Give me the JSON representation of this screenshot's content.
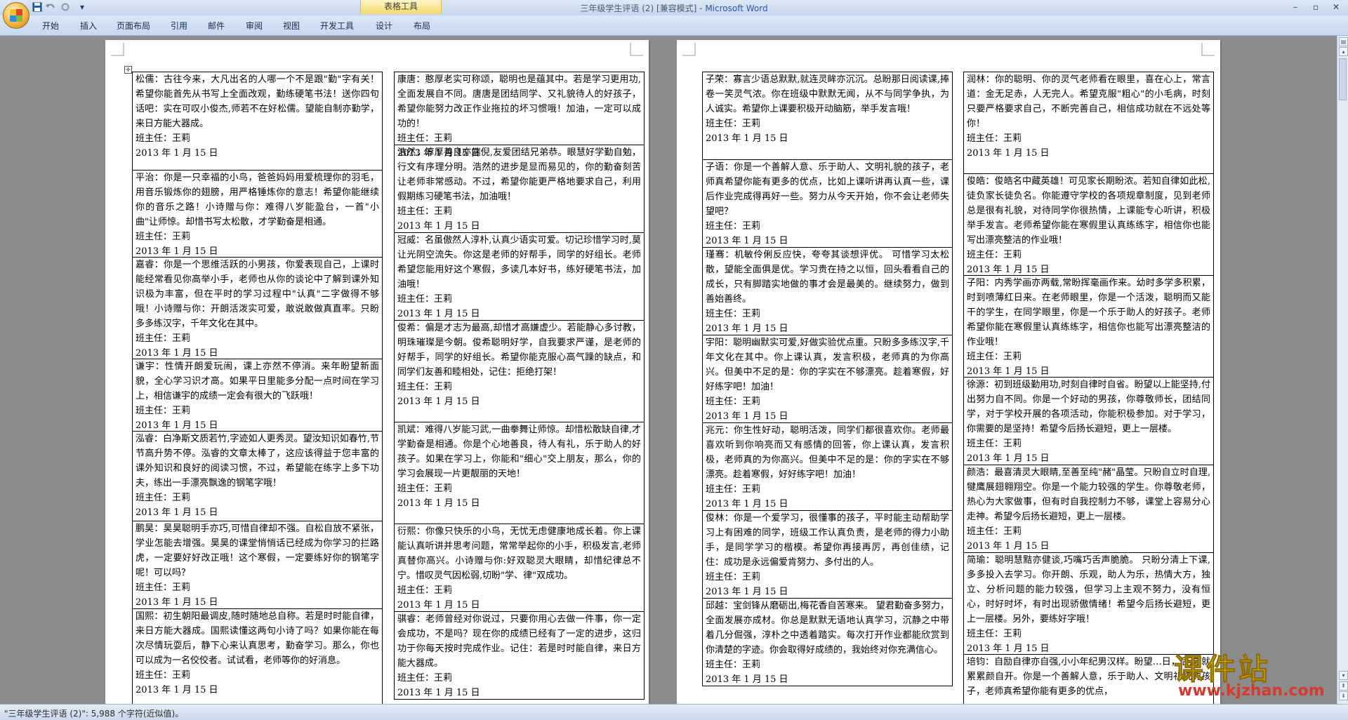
{
  "window": {
    "title": "三年级学生评语 (2) [兼容模式] - ",
    "app_name": "Microsoft Word",
    "context_tab_group": "表格工具",
    "minimize": "–",
    "restore": "▫",
    "close": "✕"
  },
  "qat": {
    "more": "▾"
  },
  "ribbon": {
    "tabs": [
      "开始",
      "插入",
      "页面布局",
      "引用",
      "邮件",
      "审阅",
      "视图",
      "开发工具",
      "设计",
      "布局"
    ],
    "help": "?"
  },
  "status": {
    "text": "\"三年级学生评语 (2)\": 5,988 个字符(近似值)。"
  },
  "watermark": {
    "title": "课件站",
    "url": "www.kjzhan.com"
  },
  "pages": [
    {
      "columns": [
        [
          {
            "text": "松儒：古往今来，大凡出名的人哪一个不是跟\"勤\"字有关！希望你能首先从书写上全面改观，勤练硬笔书法！送你四句话吧：实在可叹小俊杰,师若不在好松儒。望能自制亦勤学，来日方能大器成。",
            "teacher": "班主任：王莉",
            "date": "2013 年 1 月 15 日"
          },
          {
            "text": "平治：你是一只幸福的小鸟，爸爸妈妈用爱梳理你的羽毛，用音乐锻炼你的翅膀，用严格锤炼你的意志！希望你能继续你的音乐之路！小诗赠与你：难得八岁能盈台，一首\"小曲\"让师惊。却惜书写太松散，才学勤奋是相通。",
            "teacher": "班主任：王莉",
            "date": "2013 年 1 月 15 日"
          },
          {
            "text": "嘉睿：你是一个思维活跃的小男孩，你爱表现自己，上课时能经常看见你高举小手，老师也从你的谈论中了解到课外知识极为丰富，但在平时的学习过程中\"认真\"二字做得不够哦！小诗赠与你：开朗活泼实可爱，敢说敢做真直率。只盼多多练汉字，千年文化在其中。",
            "teacher": "班主任：王莉",
            "date": "2013 年 1 月 15 日"
          },
          {
            "text": "谦宇：性情开朗爱玩闹，课上亦然不停消。来年盼望新面貌，全心学习识才高。如果平日里能多分配一点时间在学习上，相信谦宇的成绩一定会有很大的飞跃哦！",
            "teacher": "班主任：王莉",
            "date": "2013 年 1 月 15 日"
          },
          {
            "text": "泓睿：白净斯文质若竹,字迹如人更秀灵。望汝知识如春竹,节节高升势不停。泓睿的文章太棒了，这应该得益于您丰富的课外知识和良好的阅读习惯，不过，希望能在练字上多下功夫，练出一手漂亮飘逸的钢笔字哦！",
            "teacher": "班主任：王莉",
            "date": "2013 年 1 月 15 日"
          },
          {
            "text": "鹏昊：昊昊聪明手亦巧,可惜自律却不强。自松自放不紧张，学业怎能去增强。昊昊的课堂悄悄话已经成为你学习的拦路虎，一定要好好改正哦！这个寒假，一定要练好你的钢笔字呢！可以吗？",
            "teacher": "班主任：王莉",
            "date": "2013 年 1 月 15 日"
          },
          {
            "text": "国熙：初生朝阳最调皮,随时随地总自称。若是时时能自律，来日方能大器成。国熙读懂这两句小诗了吗？如果你能在每次尽情玩耍后，静下心来认真思考，勤奋学习。那么，你也可以成为一名佼佼者。试试看，老师等你的好消息。",
            "teacher": "班主任：王莉",
            "date": "2013 年 1 月 15 日"
          }
        ],
        [
          {
            "text": "康唐：憨厚老实可称颂，聪明也是蕴其中。若是学习更用功,全面发展自不同。唐唐是团结同学、又礼貌待人的好孩子，希望你能努力改正作业拖拉的坏习惯哦！加油，一定可以成功的！",
            "teacher": "班主任：王莉",
            "date": "2013 年 1 月 15 日"
          },
          {
            "text": "浩然：淳厚善良亦端倪,友爱团结兄弟恭。眼慧好学勤自勉，行文有序理分明。浩然的进步是显而易见的，你的勤奋刻苦让老师非常感动。不过，希望你能更严格地要求自己，利用假期练习硬笔书法，加油哦！",
            "teacher": "班主任：王莉",
            "date": "2013 年 1 月 15 日"
          },
          {
            "text": "冠威：名虽傲然人淳朴,认真少语实可爱。切记珍惜学习时,莫让光阴空流失。你这是老师的好帮手，同学的好组长。老师希望您能用好这个寒假，多读几本好书，练好硬笔书法，加油哦！",
            "teacher": "班主任：王莉",
            "date": "2013 年 1 月 15 日"
          },
          {
            "text": "俊希：偏是才志为最高,却惜才高嫌虚少。若能静心多讨教，明珠璀璨是今朝。俊希聪明好学，自我要求严谨，是老师的好帮手，同学的好组长。希望你能克服心高气躁的缺点，和同学们友善和睦相处，记住：拒绝打架！",
            "teacher": "班主任：王莉",
            "date": "2013 年 1 月 15 日"
          },
          {
            "text": "凯斌：难得八岁能习武,一曲拳舞让师惊。却惜松散缺自律,才学勤奋是相通。你是个心地善良，待人有礼，乐于助人的好孩子。如果在学习上，你能和\"细心\"交上朋友，那么，你的学习会展现一片更靓丽的天地！",
            "teacher": "班主任：王莉",
            "date": "2013 年 1 月 15 日"
          },
          {
            "text": "衍熙：你像只快乐的小鸟，无忧无虑健康地成长着。你上课能认真听讲并思考问题，常常举起你的小手，积极发言,老师真替你高兴。小诗赠与你:好双聪灵大眼睛，却惜纪律总不宁。惜叹灵气因松弱,切盼\"学、律\"双成功。",
            "teacher": "班主任：王莉",
            "date": "2013 年 1 月 15 日"
          },
          {
            "text": "骐睿：老师曾经对你说过，只要你用心去做一件事，你一定会成功，不是吗？现在你的成绩已经有了一定的进步，这归功于你每天按时完成作业。记住：若是时时能自律，来日方能大器成。",
            "teacher": "班主任：王莉",
            "date": "2013 年 1 月 15 日"
          }
        ]
      ]
    },
    {
      "columns": [
        [
          {
            "text": "子荣：寡言少语总默默,就连灵眸亦沉沉。总盼那日阅读课,捧卷一笑灵气浓。你在班级中默默无闻，从不与同学争执，为人诚实。希望你上课要积极开动脑筋，举手发言哦！",
            "teacher": "班主任：王莉",
            "date": "2013 年 1 月 15 日"
          },
          {
            "text": "子语：你是一个善解人意、乐于助人、文明礼貌的孩子，老师真希望你能有更多的优点，比如上课听讲再认真一些，课后作业完成得再好一些。努力从今天开始，你不会让老师失望吧？",
            "teacher": "班主任：王莉",
            "date": "2013 年 1 月 15 日"
          },
          {
            "text": "瑾骞：机敏伶俐反应快，夸夸其谈想评优。 可惜学习太松散，望能全面俱是优。学习贵在持之以恒，回头看看自己的成长，只有脚踏实地做的事才会是最美的。继续努力，做到善始善终。",
            "teacher": "班主任：王莉",
            "date": "2013 年 1 月 15 日"
          },
          {
            "text": "宇阳：聪明幽默实可爱,好做实验优点重。只盼多多练汉字,千年文化在其中。你上课认真，发言积极，老师真的为你高兴。但美中不足的是：你的字实在不够漂亮。趁着寒假，好好练字吧！加油！",
            "teacher": "班主任：王莉",
            "date": "2013 年 1 月 15 日"
          },
          {
            "text": "兆元：你生性好动，聪明活泼，同学们都很喜欢你。老师最喜欢听到你响亮而又有感情的回答，你上课认真，发言积极，老师真的为你高兴。但美中不足的是：你的字实在不够漂亮。趁着寒假，好好练字吧！加油！",
            "teacher": "班主任：王莉",
            "date": "2013 年 1 月 15 日"
          },
          {
            "text": "俊林：你是一个爱学习，很懂事的孩子，平时能主动帮助学习上有困难的同学，班级工作认真负责，是老师的得力小助手，是同学学习的楷模。希望你再接再厉，再创佳绩，记住：成功是永远偏爱肯努力、多付出的人。",
            "teacher": "班主任：王莉",
            "date": "2013 年 1 月 15 日"
          },
          {
            "text": "邱越：宝剑锋从磨砺出,梅花香自苦寒来。 望君勤奋多努力，全面发展亦成材。你总是默默无语地认真学习，沉静之中带着几分倔强，淳朴之中透着踏实。每次打开作业都能欣赏到你清楚的字迹。你会取得好成绩的，我始终对你充满信心。",
            "teacher": "班主任：王莉",
            "date": "2013 年 1 月 15 日"
          }
        ],
        [
          {
            "text": "润林：你的聪明、你的灵气老师看在眼里，喜在心上，常言道：金无足赤，人无完人。希望克服\"粗心\"的小毛病，时刻只要严格要求自己，不断完善自己，相信成功就在不远处等你！",
            "teacher": "班主任：王莉",
            "date": "2013 年 1 月 15 日"
          },
          {
            "text": "俊皓：俊皓名中藏英雄！可见家长期盼浓。若知自律如此松,徒负家长徒负名。你能遵守学校的各项规章制度，见到老师总是很有礼貌，对待同学你很热情，上课能专心听讲，积极举手发言。老师希望你能在寒假里认真练练字，相信你也能写出漂亮整洁的作业哦！",
            "teacher": "班主任：王莉",
            "date": "2013 年 1 月 15 日"
          },
          {
            "text": "子阳：内秀学画亦两载,常盼挥毫画作来。幼时多学多积累，时到喷薄红日来。在老师眼里，你是一个活泼，聪明而又能干的学生，在同学眼里，你是一个乐于助人的好孩子。老师希望你能在寒假里认真练练字，相信你也能写出漂亮整洁的作业哦！",
            "teacher": "班主任：王莉",
            "date": "2013 年 1 月 15 日"
          },
          {
            "text": "徐源：初到班级勤用功,时刻自律时自省。盼望以上能坚持,付出努力自不同。你是一个好动的男孩，你尊敬师长，团结同学，对于学校开展的各项活动，你能积极参加。对于学习，你需要的是坚持！希望今后扬长避短，更上一层楼。",
            "teacher": "班主任：王莉",
            "date": "2013 年 1 月 15 日"
          },
          {
            "text": "颜浩：最喜清灵大眼睛,至善至纯\"赭\"晶莹。只盼自立时自理,犍鹰展翅翱翔空。你是一个能力较强的学生。你尊敬老师，热心为大家做事，但有时自我控制力不够，课堂上容易分心走神。希望今后扬长避短，更上一层楼。",
            "teacher": "班主任：王莉",
            "date": "2013 年 1 月 15 日"
          },
          {
            "text": "简瑜：聪明慧黠亦健谈,巧嘴巧舌声脆脆。 只盼分清上下课,多多投入去学习。你开朗、乐观，助人为乐，热情大方，独立、分析问题的能力较强，但学习上主观不努力，没有恒心，时好时坏，有时出现骄傲情绪！希望今后扬长避短，更上一层楼。另外，要练好字哦！",
            "teacher": "班主任：王莉",
            "date": "2013 年 1 月 15 日"
          },
          {
            "text": "培钧：自励自律亦自强,小小年纪男汉样。盼望…日，后,成就累累颜自开。你是一个善解人意，乐于助人、文明礼貌的孩子，老师真希望你能有更多的优点，",
            "teacher": "",
            "date": ""
          }
        ]
      ]
    }
  ]
}
